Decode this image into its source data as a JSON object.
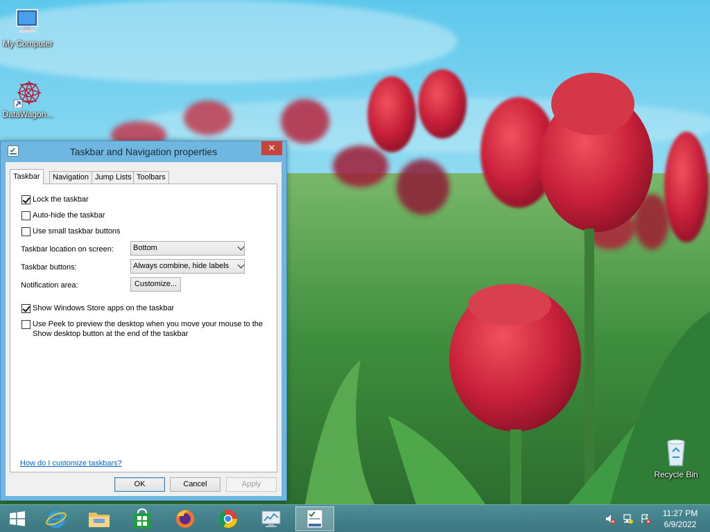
{
  "desktop": {
    "icons": [
      {
        "label": "My Computer"
      },
      {
        "label": "DataWagon..."
      },
      {
        "label": "Recycle Bin"
      }
    ]
  },
  "dialog": {
    "title": "Taskbar and Navigation properties",
    "close_label": "✕",
    "tabs": [
      "Taskbar",
      "Navigation",
      "Jump Lists",
      "Toolbars"
    ],
    "active_tab": "Taskbar",
    "options": {
      "lock_taskbar": {
        "label": "Lock the taskbar",
        "checked": true
      },
      "auto_hide": {
        "label": "Auto-hide the taskbar",
        "checked": false
      },
      "small_buttons": {
        "label": "Use small taskbar buttons",
        "checked": false
      },
      "store_apps": {
        "label": "Show Windows Store apps on the taskbar",
        "checked": true
      },
      "peek": {
        "label": "Use Peek to preview the desktop when you move your mouse to the Show desktop button at the end of the taskbar",
        "checked": false
      }
    },
    "location": {
      "label": "Taskbar location on screen:",
      "value": "Bottom"
    },
    "buttons": {
      "label": "Taskbar buttons:",
      "value": "Always combine, hide labels"
    },
    "notification": {
      "label": "Notification area:",
      "button": "Customize..."
    },
    "help_link": "How do I customize taskbars?",
    "footer": {
      "ok": "OK",
      "cancel": "Cancel",
      "apply": "Apply"
    }
  },
  "taskbar": {
    "items": [
      "start-icon",
      "internet-explorer-icon",
      "file-explorer-icon",
      "store-icon",
      "firefox-icon",
      "chrome-icon",
      "performance-monitor-icon",
      "taskbar-properties-icon"
    ],
    "tray": [
      "volume-muted-icon",
      "network-icon",
      "action-center-icon"
    ],
    "time": "11:27 PM",
    "date": "6/9/2022"
  },
  "colors": {
    "accent": "#6fb6e0",
    "close_button": "#c7443c",
    "taskbar": "#3c7781",
    "link": "#0066cc"
  }
}
